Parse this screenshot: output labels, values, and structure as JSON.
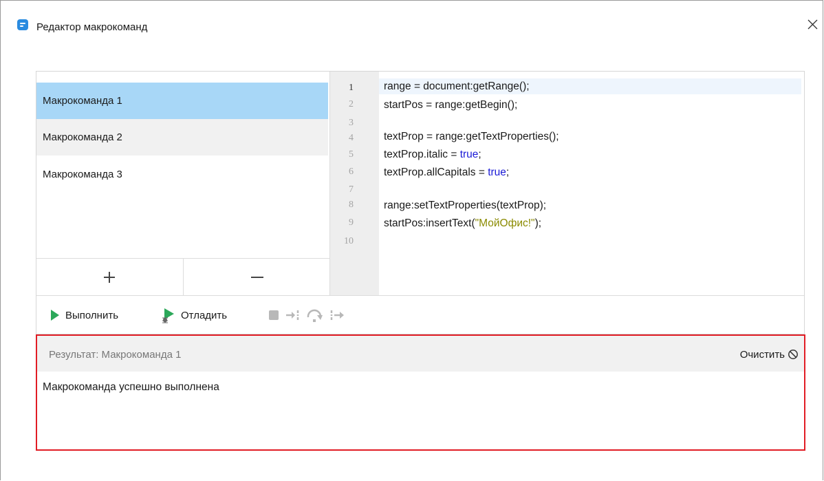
{
  "window": {
    "title": "Редактор макрокоманд"
  },
  "macros": {
    "items": [
      "Макрокоманда 1",
      "Макрокоманда 2",
      "Макрокоманда 3"
    ],
    "selected": "Макрокоманда 1"
  },
  "editor": {
    "line_numbers": [
      "1",
      "2",
      "3",
      "4",
      "5",
      "6",
      "7",
      "8",
      "9",
      "10"
    ],
    "current_line": 1,
    "lines": [
      "range = document:getRange();",
      "startPos = range:getBegin();",
      "",
      "textProp = range:getTextProperties();",
      "textProp.italic = true;",
      "textProp.allCapitals = true;",
      "",
      "range:setTextProperties(textProp);",
      "startPos:insertText(\"МойОфис!\");",
      ""
    ],
    "parts": {
      "l5a": "textProp.italic = ",
      "l5b": "true",
      "l5c": ";",
      "l6a": "textProp.allCapitals = ",
      "l6b": "true",
      "l6c": ";",
      "l9a": "startPos:insertText(",
      "l9b": "\"МойОфис!\"",
      "l9c": ");"
    },
    "colors": {
      "keyword": "#1a1ad6",
      "string": "#8a8a00",
      "current_line_bg": "#eef5fd"
    }
  },
  "toolbar": {
    "run_label": "Выполнить",
    "debug_label": "Отладить"
  },
  "result": {
    "title": "Результат: Макрокоманда 1",
    "clear_label": "Очистить",
    "message": "Макрокоманда успешно выполнена"
  },
  "colors": {
    "selected_item": "#a8d7f7",
    "accent_green": "#2ca85a",
    "highlight_border": "#e11c24",
    "app_icon": "#2a8be0"
  }
}
